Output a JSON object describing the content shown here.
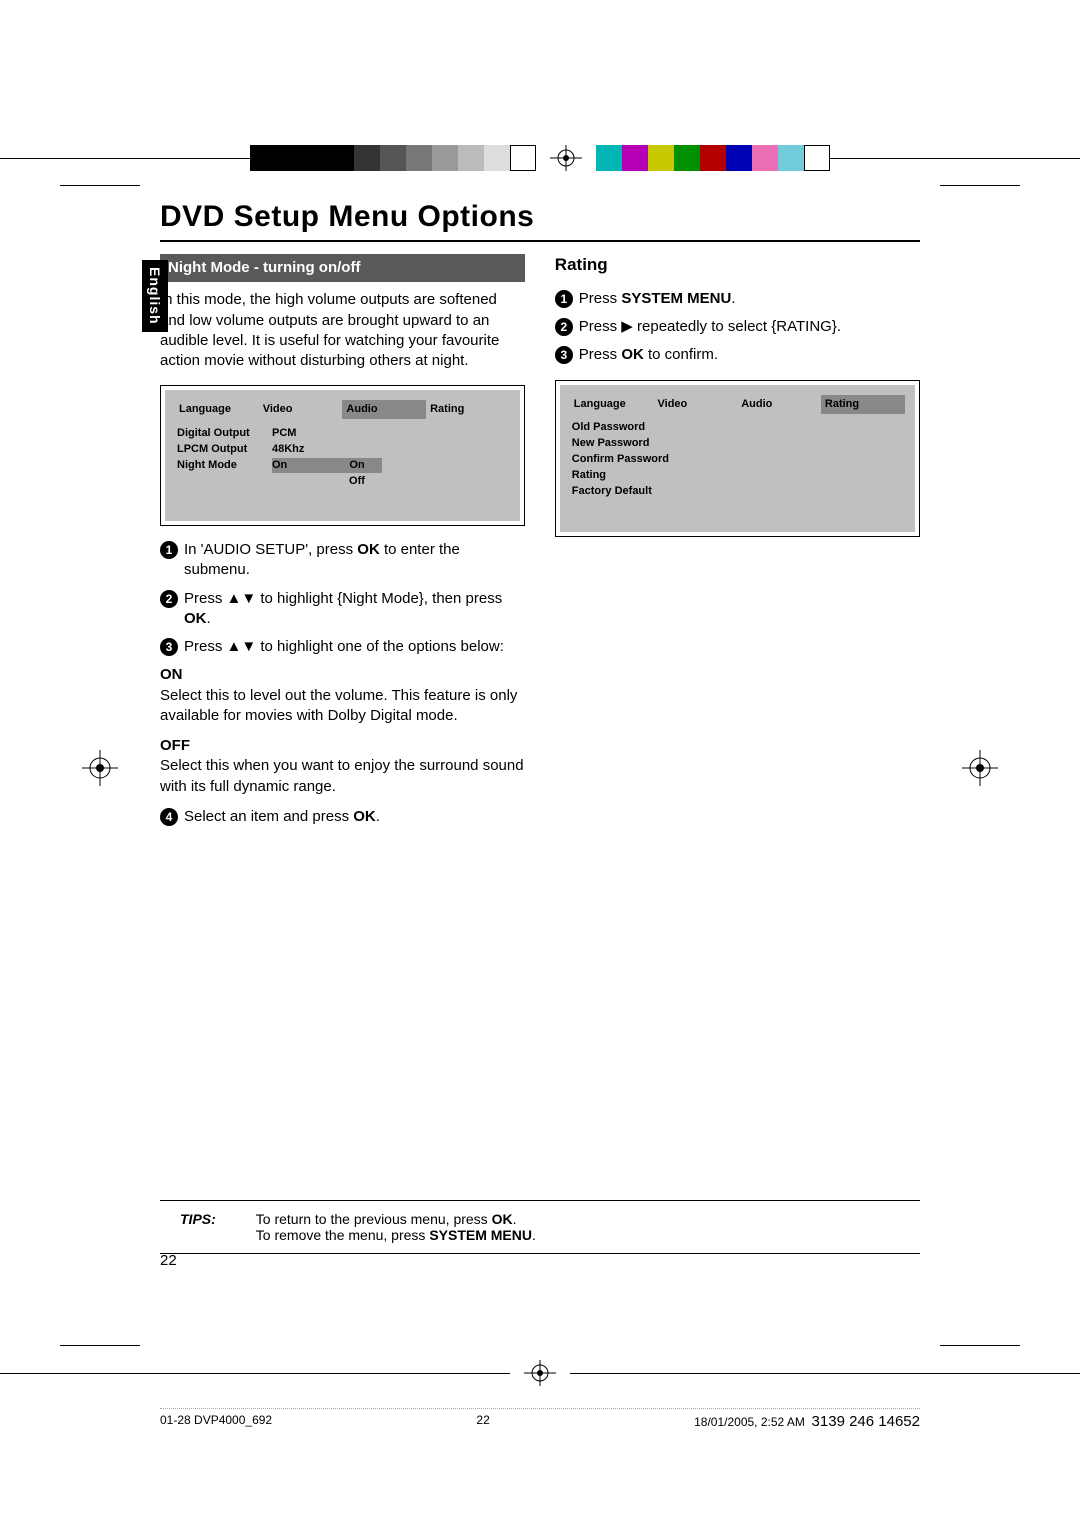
{
  "page_title": "DVD Setup Menu Options",
  "language_tab": "English",
  "left": {
    "section_title": "Night Mode - turning on/off",
    "intro": "In this mode, the high volume outputs are softened and low volume outputs are brought upward to an audible level. It is useful for watching your favourite action movie without disturbing others at night.",
    "osd": {
      "tabs": [
        "Language",
        "Video",
        "Audio",
        "Rating"
      ],
      "selected_tab_index": 2,
      "rows": [
        {
          "label": "Digital Output",
          "value": "PCM",
          "opt": ""
        },
        {
          "label": "LPCM Output",
          "value": "48Khz",
          "opt": ""
        },
        {
          "label": "Night Mode",
          "value": "On",
          "opt": "On",
          "opt2": "Off"
        }
      ]
    },
    "steps": [
      {
        "n": "1",
        "pre": "In 'AUDIO SETUP', press ",
        "bold": "OK",
        "post": " to enter the submenu."
      },
      {
        "n": "2",
        "pre": "Press ▲▼ to highlight {Night Mode}, then press ",
        "bold": "OK",
        "post": "."
      },
      {
        "n": "3",
        "pre": "Press ▲▼ to highlight one of the options below:",
        "bold": "",
        "post": ""
      }
    ],
    "on_label": "ON",
    "on_text": "Select this to level out the volume. This feature is only available for movies with Dolby Digital mode.",
    "off_label": "OFF",
    "off_text": "Select this when you want to enjoy the surround sound with its full dynamic range.",
    "step4": {
      "n": "4",
      "pre": "Select an item and press ",
      "bold": "OK",
      "post": "."
    }
  },
  "right": {
    "section_title": "Rating",
    "steps": [
      {
        "n": "1",
        "pre": "Press ",
        "bold": "SYSTEM MENU",
        "post": "."
      },
      {
        "n": "2",
        "pre": "Press ▶ repeatedly to select {RATING}.",
        "bold": "",
        "post": ""
      },
      {
        "n": "3",
        "pre": "Press ",
        "bold": "OK",
        "post": " to confirm."
      }
    ],
    "osd": {
      "tabs": [
        "Language",
        "Video",
        "Audio",
        "Rating"
      ],
      "selected_tab_index": 3,
      "rows": [
        {
          "label": "Old Password"
        },
        {
          "label": "New Password"
        },
        {
          "label": "Confirm Password"
        },
        {
          "label": "Rating"
        },
        {
          "label": "Factory Default"
        }
      ]
    }
  },
  "tips": {
    "label": "TIPS:",
    "line1_pre": "To return to the previous menu, press ",
    "line1_bold": "OK",
    "line1_post": ".",
    "line2_pre": "To remove the menu, press ",
    "line2_bold": "SYSTEM MENU",
    "line2_post": "."
  },
  "page_number": "22",
  "footer": {
    "left": "01-28 DVP4000_692",
    "center": "22",
    "right": "18/01/2005, 2:52 AM",
    "right2": "3139 246 14652"
  },
  "reg_colors_left": [
    "#000",
    "#000",
    "#000",
    "#000",
    "#3a3a3a",
    "#5a5a5a",
    "#7a7a7a",
    "#9a9a9a",
    "#bababa",
    "#dadada",
    "#ffffff"
  ],
  "reg_colors_right": [
    "#00aqpopulated below"
  ]
}
